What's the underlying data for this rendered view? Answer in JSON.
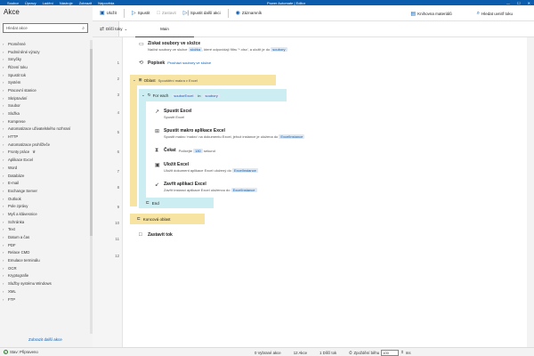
{
  "window": {
    "title": "Power Automate | Editor",
    "menu": [
      "Soubor",
      "Úpravy",
      "Ladění",
      "Nástroje",
      "Zobrazit",
      "Nápověda"
    ],
    "controls": [
      "—",
      "☐",
      "✕"
    ]
  },
  "actions_panel": {
    "title": "Akce",
    "search_placeholder": "Hledat akce",
    "items": [
      "Proměnné",
      "Podmíněné výrazy",
      "Smyčky",
      "Řízení toku",
      "Spustit tok",
      "Systém",
      "Pracovní stanice",
      "Skriptování",
      "Soubor",
      "Složka",
      "Komprese",
      "Automatizace uživatelského rozhraní",
      "HTTP",
      "Automatizace prohlížeče",
      "Fronty práce",
      "Aplikace Excel",
      "Word",
      "Databáze",
      "E-mail",
      "Exchange Server",
      "Outlook",
      "Pole zprávy",
      "Myš a klávesnice",
      "Schránka",
      "Text",
      "Datum a čas",
      "PDF",
      "Relace CMD",
      "Emulace terminálu",
      "OCR",
      "Kryptografie",
      "Služby systému Windows",
      "XML",
      "FTP"
    ],
    "more_link": "Zobrazit další akce"
  },
  "toolbar": {
    "save": "Uložit",
    "run": "Spustit",
    "stop": "Zastavit",
    "run_next": "Spustit další akci",
    "recorder": "Záznamník",
    "assets": "Knihovna materiálů",
    "search": "Hledat uvnitř toku"
  },
  "subflows": {
    "label": "Dílčí toky",
    "tab": "Main"
  },
  "line_numbers": [
    "1",
    "2",
    "3",
    "4",
    "5",
    "6",
    "7",
    "8",
    "9",
    "10",
    "11",
    "12"
  ],
  "steps": {
    "s1": {
      "title": "Získat soubory ve složce",
      "desc_a": "Načíst soubory ve složce",
      "pill1": "složka",
      "desc_b": ", které odpovídají filtru '*.xlsx', a uložit je do",
      "pill2": "soubory"
    },
    "s2": {
      "title": "Popisek",
      "desc": "Prochází soubory ve složce"
    },
    "s3": {
      "title": "Oblast",
      "desc": "Spouštění makra v Excel"
    },
    "s4": {
      "title": "For each",
      "var": "souborExcel",
      "in": "in",
      "list": "soubory"
    },
    "s5": {
      "title": "Spustit Excel",
      "desc": "Spustit Excel"
    },
    "s6": {
      "title": "Spustit makro aplikace Excel",
      "desc": "Spustit makro 'makro' na dokumentu Excel, jehož instance je uložena do",
      "pill": "ExcelInstance"
    },
    "s7": {
      "title": "Čekat",
      "desc_a": "Počkejte",
      "pill": "180",
      "desc_b": "sekund"
    },
    "s8": {
      "title": "Uložit Excel",
      "desc": "Uložit dokument aplikace Excel uložený do",
      "pill": "ExcelInstance"
    },
    "s9": {
      "title": "Zavřít aplikaci Excel",
      "desc": "Zavřít instanci aplikace Excel uloženou do",
      "pill": "ExcelInstance"
    },
    "s10": {
      "title": "End"
    },
    "s11": {
      "title": "Koncová oblast"
    },
    "s12": {
      "title": "Zastavit tok"
    }
  },
  "status_bar": {
    "status": "Stav: Připraveno",
    "selected": "0 Vybrané akce",
    "actions": "12 Akce",
    "subflows": "1 Dílčí tok",
    "delay_label": "Zpoždění běhu",
    "delay_value": "100",
    "delay_unit": "ms"
  },
  "colors": {
    "accent": "#0b5cad",
    "region": "#f7e4a2",
    "loop": "#cceef3",
    "pill": "#dde9f7"
  }
}
